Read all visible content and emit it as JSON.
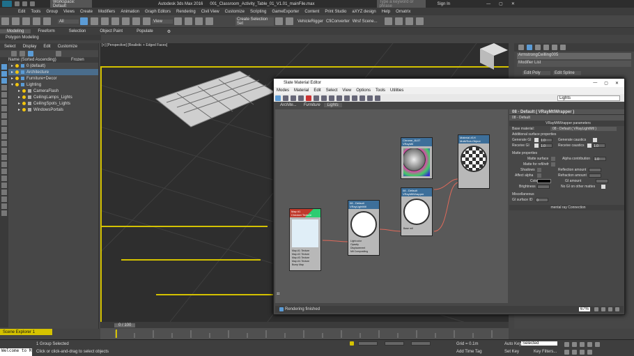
{
  "titlebar": {
    "workspace": "Workspace: Default",
    "app": "Autodesk 3ds Max 2016",
    "file": "001_Classroom_Activity_Table_01_V1.01_mainFile.max",
    "search_placeholder": "Type a keyword or phrase",
    "sign_in": "Sign In"
  },
  "menubar": [
    "Edit",
    "Tools",
    "Group",
    "Views",
    "Create",
    "Modifiers",
    "Animation",
    "Graph Editors",
    "Rendering",
    "Civil View",
    "Customize",
    "Scripting",
    "GameExporter",
    "Content",
    "Print Studio",
    "aXYZ design",
    "Help",
    "Ornatrix"
  ],
  "toolbar": {
    "selection_set": "All",
    "view_dropdown": "View",
    "sets_dropdown": "Create Selection Set",
    "plugins": [
      "VehicleRigger",
      "CfiConverter",
      "Wrsf Scene..."
    ]
  },
  "ribbon": {
    "tabs": [
      "Modeling",
      "Freeform",
      "Selection",
      "Object Paint",
      "Populate"
    ],
    "sub": "Polygon Modeling"
  },
  "explorer": {
    "menu": [
      "Select",
      "Display",
      "Edit",
      "Customize"
    ],
    "col_name": "Name (Sorted Ascending)",
    "col_frozen": "Frozen",
    "items": [
      {
        "label": "0 (default)",
        "level": 1
      },
      {
        "label": "Architecture",
        "level": 1
      },
      {
        "label": "Furniture+Decor",
        "level": 1
      },
      {
        "label": "Lighting",
        "level": 1
      },
      {
        "label": "CameraFlash",
        "level": 2
      },
      {
        "label": "CeilingLamps_Lights",
        "level": 2
      },
      {
        "label": "CeilingSpots_Lights",
        "level": 2
      },
      {
        "label": "WindowsPortals",
        "level": 2
      }
    ],
    "footer": "Scene Explorer 1"
  },
  "viewport": {
    "label": "[+] [Perspective] [Realistic + Edged Faces]"
  },
  "right_panel": {
    "object_name": "ArmstrongCeilling005",
    "modifier_list": "Modifier List",
    "tabs": [
      "Edit Poly",
      "Edit Spline"
    ]
  },
  "sme": {
    "title": "Slate Material Editor",
    "menu": [
      "Modes",
      "Material",
      "Edit",
      "Select",
      "View",
      "Options",
      "Tools",
      "Utilities"
    ],
    "view_dropdown": "Lights",
    "view_tabs": [
      "Archite...",
      "Furniture",
      "Lights"
    ],
    "status": "Rendering finished",
    "zoom": "67%",
    "nodes": {
      "map": {
        "title": "Map #1",
        "sub": "Checker Texture",
        "slots": [
          "Map #1: Texture",
          "Map #2: Texture",
          "Map #3: Texture",
          "Map #4: Texture",
          "Bump Map"
        ]
      },
      "vraylight": {
        "title": "08 - Default",
        "sub": "VRayLightMtl",
        "slots": [
          "Light color",
          "Opacity",
          "Displacement",
          "Mtl Compositing"
        ]
      },
      "wrapper": {
        "title": "08 - Default",
        "sub": "VRayMtlWrapper",
        "slots": [
          "Base mtl"
        ]
      },
      "chrome": {
        "title": "Chrome_8L07",
        "sub": "VRayMtl"
      },
      "objmat": {
        "title": "Material #1H",
        "sub": "Multi/Sub-Object"
      }
    },
    "props": {
      "header": "08 - Default ( VRayMtlWrapper )",
      "name": "08 - Default",
      "rollout_wrapper": "VRayMtlWrapper parameters",
      "base_material_label": "Base material:",
      "base_material_value": "08 - Default ( VRayLightMtl )",
      "surface_group": "Additional surface properties",
      "generate_gi": "Generate GI",
      "generate_gi_val": "1.0",
      "generate_caustics": "Generate caustics",
      "receive_gi": "Receive GI",
      "receive_gi_val": "1.0",
      "receive_caustics": "Receive caustics",
      "receive_caustics_val": "1.0",
      "matte_group": "Matte properties",
      "matte_surface": "Matte surface",
      "alpha_contribution": "Alpha contribution",
      "alpha_val": "1.0",
      "matte_refl": "Matte for refl/refr",
      "shadows": "Shadows",
      "reflection_amount": "Reflection amount",
      "affect_alpha": "Affect alpha",
      "refraction_amount": "Refraction amount",
      "color": "Color",
      "gi_amount": "GI amount",
      "brightness": "Brightness",
      "no_gi": "No GI on other mattes",
      "misc_group": "Miscellaneous",
      "gi_surface_id": "GI surface ID",
      "gi_surface_val": "0",
      "mental_ray": "mental ray Connection"
    }
  },
  "timeline": {
    "frame": "0 / 100"
  },
  "status": {
    "console": "Welcome to M",
    "selected": "1 Group Selected",
    "hint": "Click or click-and-drag to select objects",
    "grid": "Grid = 0.1m",
    "add_time_tag": "Add Time Tag",
    "auto_key": "Auto Key",
    "set_key": "Set Key",
    "selected_dropdown": "Selected",
    "key_filters": "Key Filters..."
  },
  "colors": {
    "bg": "#474747",
    "accent": "#5b9bd5",
    "node_red": "#c0392b",
    "node_green": "#2ecc71",
    "wire": "#e06a5a"
  }
}
